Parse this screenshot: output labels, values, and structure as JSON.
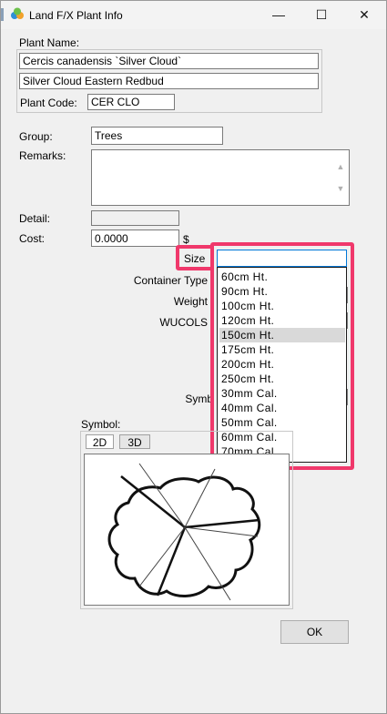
{
  "window": {
    "title": "Land F/X Plant Info",
    "minimize_glyph": "—",
    "maximize_glyph": "☐",
    "close_glyph": "✕"
  },
  "plant_name": {
    "label": "Plant Name:",
    "botanical": "Cercis canadensis `Silver Cloud`",
    "common": "Silver Cloud Eastern Redbud",
    "code_label": "Plant Code:",
    "code": "CER CLO"
  },
  "group": {
    "label": "Group:",
    "value": "Trees"
  },
  "remarks": {
    "label": "Remarks:",
    "value": ""
  },
  "detail": {
    "label": "Detail:",
    "value": ""
  },
  "cost": {
    "label": "Cost:",
    "value": "0.0000",
    "currency": "$"
  },
  "size": {
    "label": "Size",
    "value": "",
    "options": [
      "60cm Ht.",
      "90cm Ht.",
      "100cm Ht.",
      "120cm Ht.",
      "150cm Ht.",
      "175cm Ht.",
      "200cm Ht.",
      "250cm Ht.",
      "30mm Cal.",
      "40mm Cal.",
      "50mm Cal.",
      "60mm Cal.",
      "70mm Cal."
    ],
    "hovered_option": "150cm Ht."
  },
  "container_type": {
    "label": "Container Type"
  },
  "weight": {
    "label": "Weight"
  },
  "wucols": {
    "label": "WUCOLS"
  },
  "symbol_field": {
    "label": "Symb"
  },
  "symbol_preview": {
    "label": "Symbol:",
    "tabs": [
      "2D",
      "3D"
    ],
    "active_tab": "2D"
  },
  "ok_button": {
    "label": "OK"
  },
  "colors": {
    "highlight": "#f0386b",
    "hover": "#d9d9d9"
  }
}
